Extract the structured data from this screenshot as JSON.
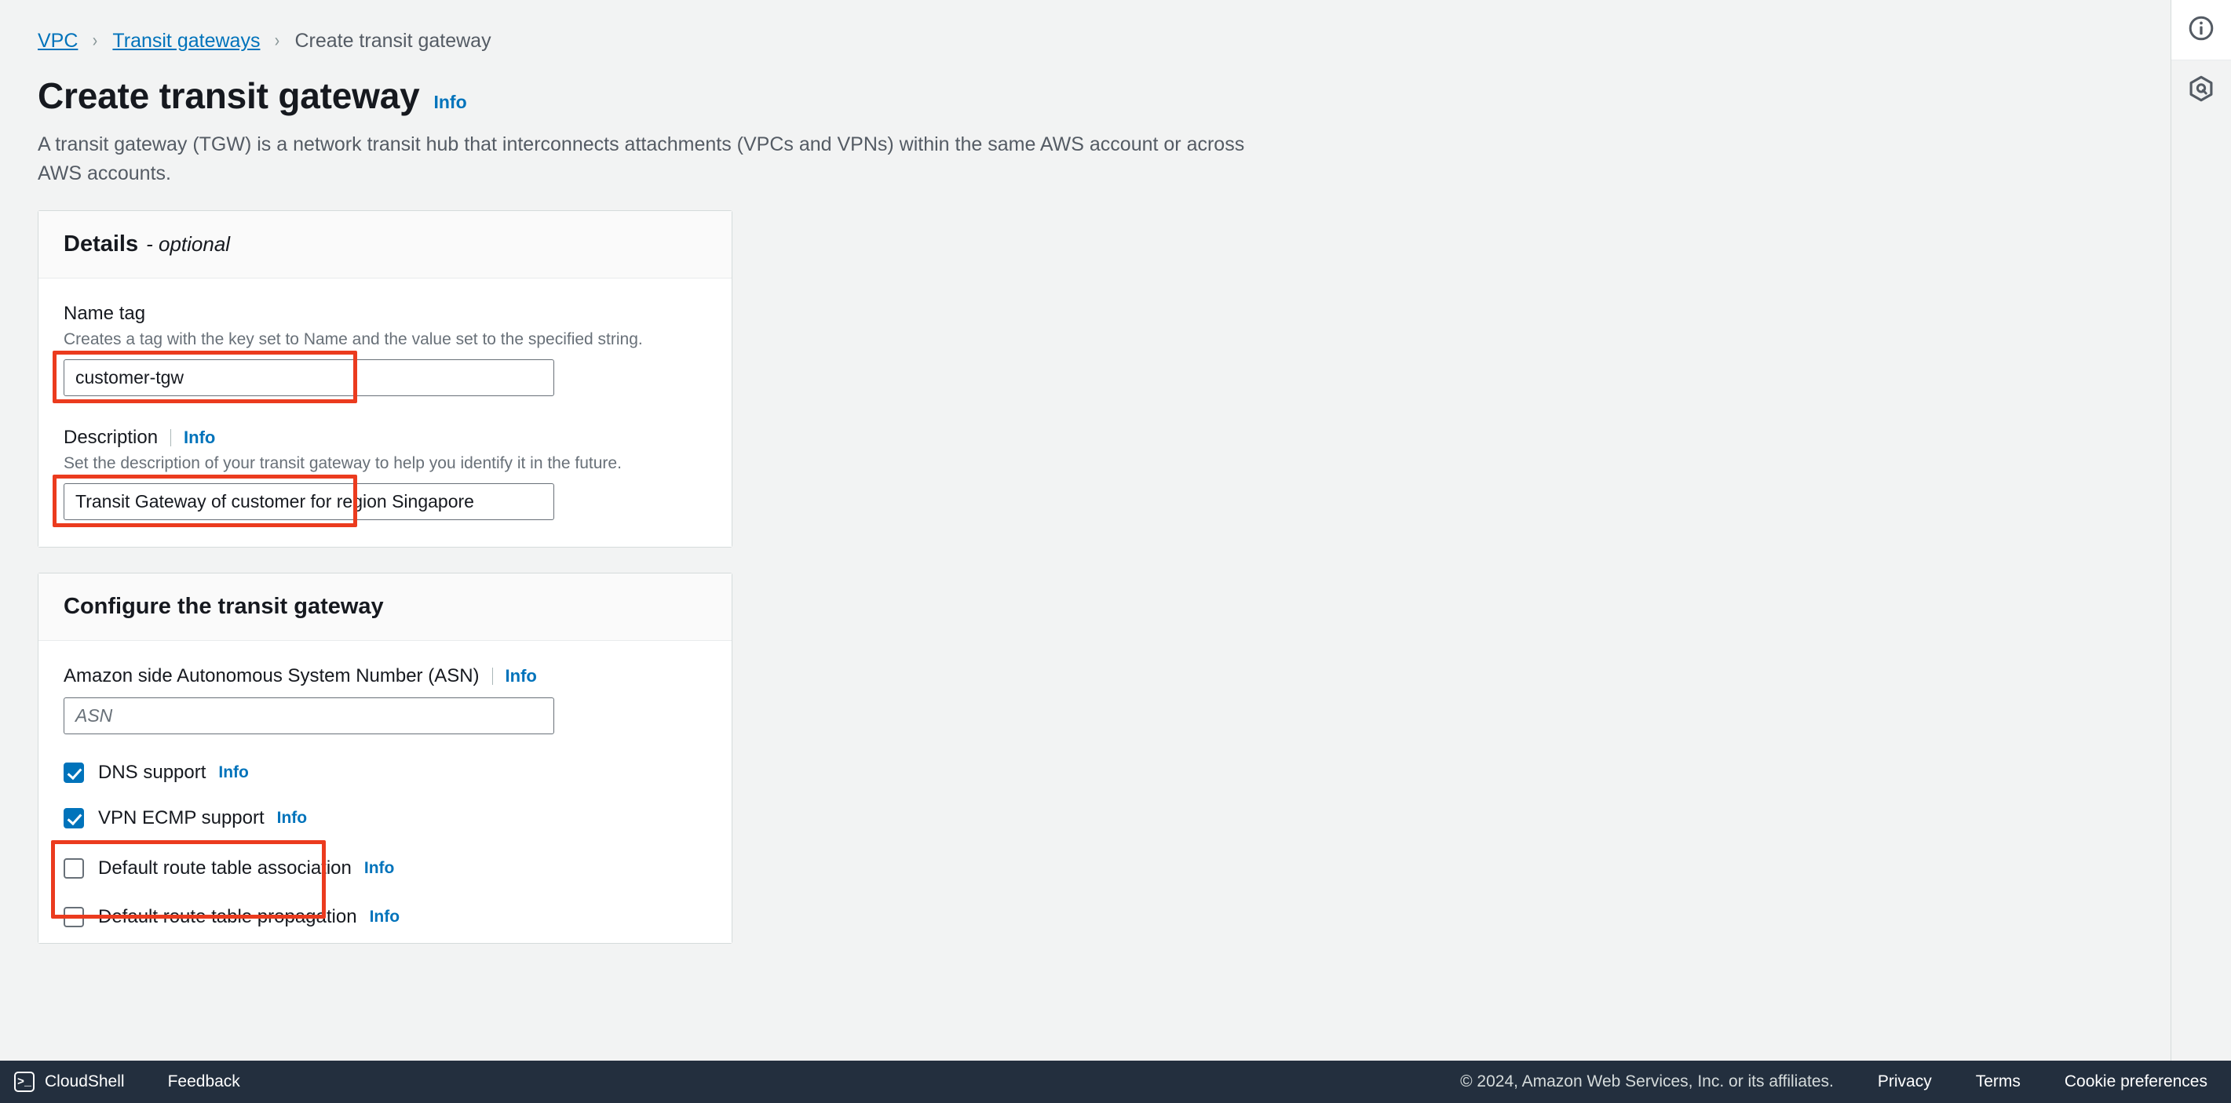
{
  "breadcrumb": {
    "items": [
      {
        "label": "VPC",
        "type": "link"
      },
      {
        "label": "Transit gateways",
        "type": "link"
      },
      {
        "label": "Create transit gateway",
        "type": "current"
      }
    ],
    "separator": "›"
  },
  "header": {
    "title": "Create transit gateway",
    "info_label": "Info",
    "description": "A transit gateway (TGW) is a network transit hub that interconnects attachments (VPCs and VPNs) within the same AWS account or across AWS accounts."
  },
  "details_card": {
    "title": "Details",
    "title_suffix": "- optional",
    "name_tag": {
      "label": "Name tag",
      "description": "Creates a tag with the key set to Name and the value set to the specified string.",
      "value": "customer-tgw",
      "highlighted": true
    },
    "description_field": {
      "label": "Description",
      "info_label": "Info",
      "description": "Set the description of your transit gateway to help you identify it in the future.",
      "value": "Transit Gateway of customer for region Singapore",
      "highlighted": true
    }
  },
  "configure_card": {
    "title": "Configure the transit gateway",
    "asn": {
      "label": "Amazon side Autonomous System Number (ASN)",
      "info_label": "Info",
      "placeholder": "ASN",
      "value": ""
    },
    "checkboxes": [
      {
        "label": "DNS support",
        "info_label": "Info",
        "checked": true,
        "highlighted": false
      },
      {
        "label": "VPN ECMP support",
        "info_label": "Info",
        "checked": true,
        "highlighted": false
      },
      {
        "label": "Default route table association",
        "info_label": "Info",
        "checked": false,
        "highlighted": true
      },
      {
        "label": "Default route table propagation",
        "info_label": "Info",
        "checked": false,
        "highlighted": true
      }
    ]
  },
  "right_rail": {
    "info_icon": "info-circle-icon",
    "assistant_icon": "amazon-q-icon"
  },
  "footer": {
    "cloudshell_label": "CloudShell",
    "cloudshell_icon_glyph": ">_",
    "feedback_label": "Feedback",
    "copyright": "© 2024, Amazon Web Services, Inc. or its affiliates.",
    "links": [
      "Privacy",
      "Terms",
      "Cookie preferences"
    ]
  },
  "colors": {
    "accent_link": "#0073bb",
    "highlight_box": "#eb3b1e",
    "page_background": "#f2f3f3",
    "footer_background": "#232f3e",
    "checkbox_checked": "#0073bb"
  }
}
